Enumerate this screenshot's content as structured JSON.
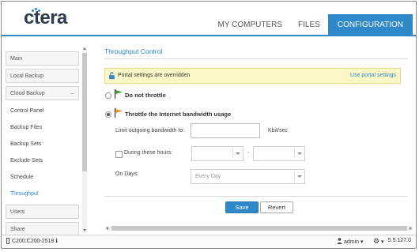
{
  "brand": {
    "logo": "ctera",
    "accent": "#2e88c9"
  },
  "nav": {
    "tabs": [
      "MY COMPUTERS",
      "FILES",
      "CONFIGURATION"
    ],
    "active": "CONFIGURATION"
  },
  "sidebar": {
    "groups": [
      "Main",
      "Local Backup",
      "Cloud Backup",
      "Users",
      "Share"
    ],
    "cloud_backup_items": [
      "Control Panel",
      "Backup Files",
      "Backup Sets",
      "Exclude Sets",
      "Schedule",
      "Throughput"
    ],
    "active_item": "Throughput"
  },
  "page": {
    "title": "Throughput Control",
    "alert": {
      "message": "Portal settings are overridden",
      "link": "Use portal settings",
      "icon": "lock-icon"
    },
    "option_no_throttle": "Do not throttle",
    "option_throttle": "Throttle the Internet bandwidth usage",
    "limit_label": "Limit outgoing bandwidth to:",
    "limit_value": "",
    "limit_unit": "Kbit/sec",
    "hours_label": "During these hours:",
    "hours_separator": "-",
    "days_label": "On Days:",
    "days_value": "Every Day",
    "save_label": "Save",
    "revert_label": "Revert"
  },
  "status": {
    "device": "C200:C200-2518",
    "device_icon": "ℹ",
    "user": "admin",
    "version": "5.5.127.0"
  }
}
